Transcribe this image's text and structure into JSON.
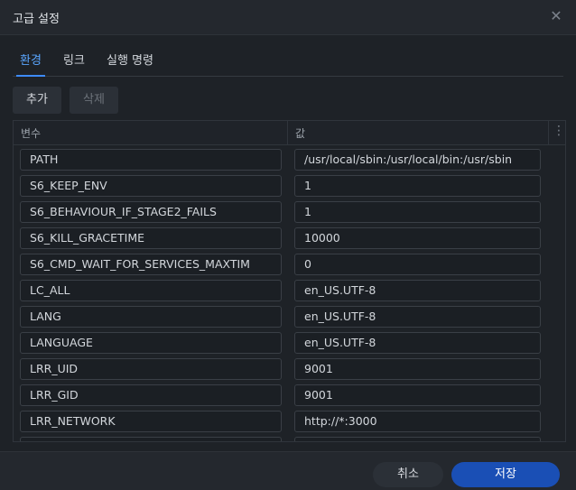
{
  "dialog": {
    "title": "고급 설정",
    "close_icon": "close-icon"
  },
  "tabs": [
    {
      "label": "환경",
      "active": true
    },
    {
      "label": "링크",
      "active": false
    },
    {
      "label": "실행 명령",
      "active": false
    }
  ],
  "toolbar": {
    "add_label": "추가",
    "delete_label": "삭제"
  },
  "table": {
    "headers": [
      "변수",
      "값"
    ],
    "menu_icon": "kebab-icon",
    "rows": [
      {
        "name": "PATH",
        "value": "/usr/local/sbin:/usr/local/bin:/usr/sbin"
      },
      {
        "name": "S6_KEEP_ENV",
        "value": "1"
      },
      {
        "name": "S6_BEHAVIOUR_IF_STAGE2_FAILS",
        "value": "1"
      },
      {
        "name": "S6_KILL_GRACETIME",
        "value": "10000"
      },
      {
        "name": "S6_CMD_WAIT_FOR_SERVICES_MAXTIM",
        "value": "0"
      },
      {
        "name": "LC_ALL",
        "value": "en_US.UTF-8"
      },
      {
        "name": "LANG",
        "value": "en_US.UTF-8"
      },
      {
        "name": "LANGUAGE",
        "value": "en_US.UTF-8"
      },
      {
        "name": "LRR_UID",
        "value": "9001"
      },
      {
        "name": "LRR_GID",
        "value": "9001"
      },
      {
        "name": "LRR_NETWORK",
        "value": "http://*:3000"
      }
    ]
  },
  "footer": {
    "cancel_label": "취소",
    "save_label": "저장"
  },
  "colors": {
    "accent": "#3d8bfd",
    "primary_button": "#1a4fb5",
    "background": "#1e2227"
  }
}
